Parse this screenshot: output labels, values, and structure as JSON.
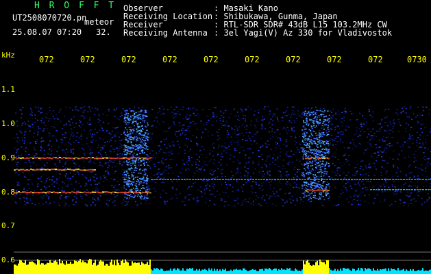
{
  "brand": "H R O F F T",
  "file_name": "UT2508070720.pn",
  "mode": "meteor",
  "stamp": {
    "date": "25.08.07 07:20",
    "value": "32."
  },
  "header": [
    {
      "label": "Observer",
      "value": ": Masaki Kano"
    },
    {
      "label": "Receiving Location",
      "value": ": Shibukawa, Gunma, Japan"
    },
    {
      "label": "Receiver",
      "value": ": RTL-SDR SDR# 43dB L15 103.2MHz CW"
    },
    {
      "label": "Receiving Antenna",
      "value": ": 3el Yagi(V) Az 330 for Vladivostok"
    }
  ],
  "axis": {
    "unit": "kHz",
    "y_ticks": [
      "1.1",
      "1.0",
      "0.9",
      "0.8",
      "0.7",
      "0.6"
    ],
    "x_ticks": [
      "072",
      "072",
      "072",
      "072",
      "072",
      "072",
      "072",
      "072",
      "072",
      "0730"
    ]
  },
  "colors": {
    "green": "#33ff66",
    "yellow": "#ffff00",
    "cyan": "#00e5ff",
    "noise": "#1a2bd9"
  }
}
